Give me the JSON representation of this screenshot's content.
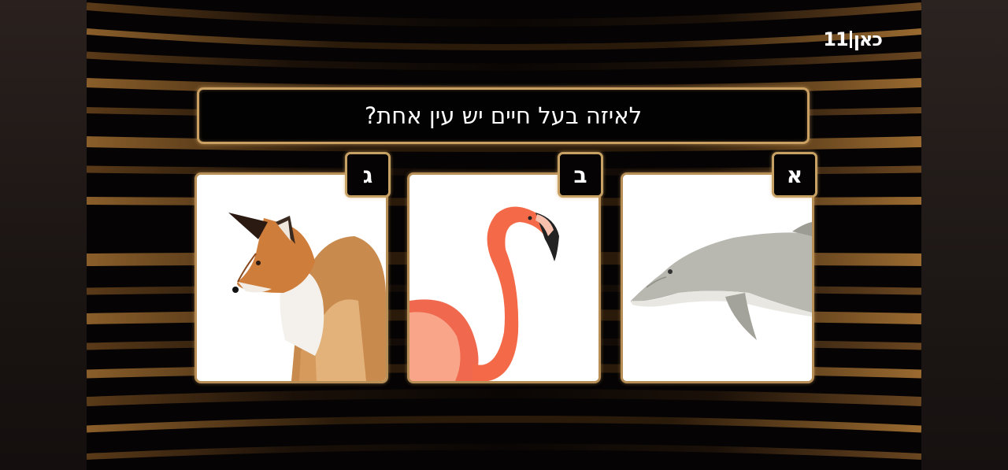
{
  "channel_logo": {
    "left": "כאן",
    "right": "11"
  },
  "question": "לאיזה בעל חיים יש עין אחת?",
  "answers": [
    {
      "letter": "א",
      "animal_icon": "dolphin"
    },
    {
      "letter": "ב",
      "animal_icon": "flamingo"
    },
    {
      "letter": "ג",
      "animal_icon": "fox"
    }
  ],
  "colors": {
    "gold_frame": "#c9a062",
    "panel_bg": "#030202",
    "text": "#ffffff"
  }
}
